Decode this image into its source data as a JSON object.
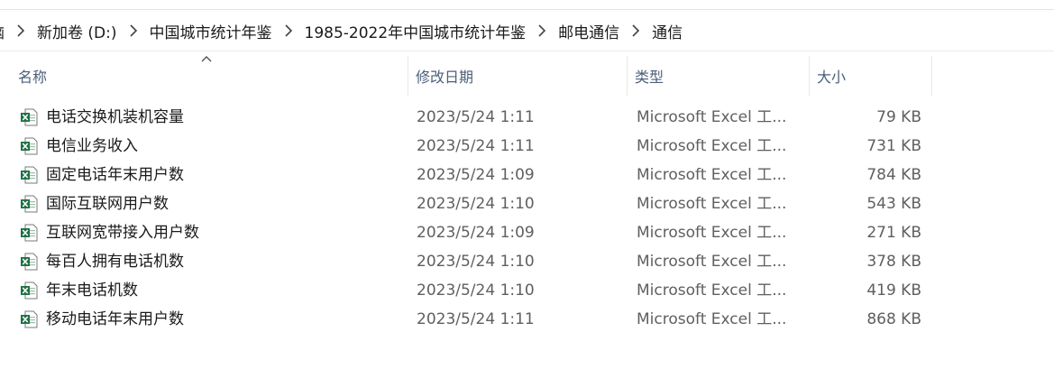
{
  "breadcrumb": {
    "items": [
      "脑",
      "新加卷 (D:)",
      "中国城市统计年鉴",
      "1985-2022年中国城市统计年鉴",
      "邮电通信",
      "通信"
    ]
  },
  "columns": {
    "name": "名称",
    "date": "修改日期",
    "type": "类型",
    "size": "大小"
  },
  "files": [
    {
      "name": "电话交换机装机容量",
      "date": "2023/5/24 1:11",
      "type": "Microsoft Excel 工...",
      "size": "79 KB",
      "icon": "excel-file-icon"
    },
    {
      "name": "电信业务收入",
      "date": "2023/5/24 1:11",
      "type": "Microsoft Excel 工...",
      "size": "731 KB",
      "icon": "excel-file-icon"
    },
    {
      "name": "固定电话年末用户数",
      "date": "2023/5/24 1:09",
      "type": "Microsoft Excel 工...",
      "size": "784 KB",
      "icon": "excel-file-icon"
    },
    {
      "name": "国际互联网用户数",
      "date": "2023/5/24 1:10",
      "type": "Microsoft Excel 工...",
      "size": "543 KB",
      "icon": "excel-file-icon"
    },
    {
      "name": "互联网宽带接入用户数",
      "date": "2023/5/24 1:09",
      "type": "Microsoft Excel 工...",
      "size": "271 KB",
      "icon": "excel-file-icon"
    },
    {
      "name": "每百人拥有电话机数",
      "date": "2023/5/24 1:10",
      "type": "Microsoft Excel 工...",
      "size": "378 KB",
      "icon": "excel-file-icon"
    },
    {
      "name": "年末电话机数",
      "date": "2023/5/24 1:10",
      "type": "Microsoft Excel 工...",
      "size": "419 KB",
      "icon": "excel-file-icon"
    },
    {
      "name": "移动电话年末用户数",
      "date": "2023/5/24 1:11",
      "type": "Microsoft Excel 工...",
      "size": "868 KB",
      "icon": "excel-file-icon"
    }
  ],
  "colors": {
    "header_text": "#4c607a",
    "excel_green": "#1e7145"
  }
}
